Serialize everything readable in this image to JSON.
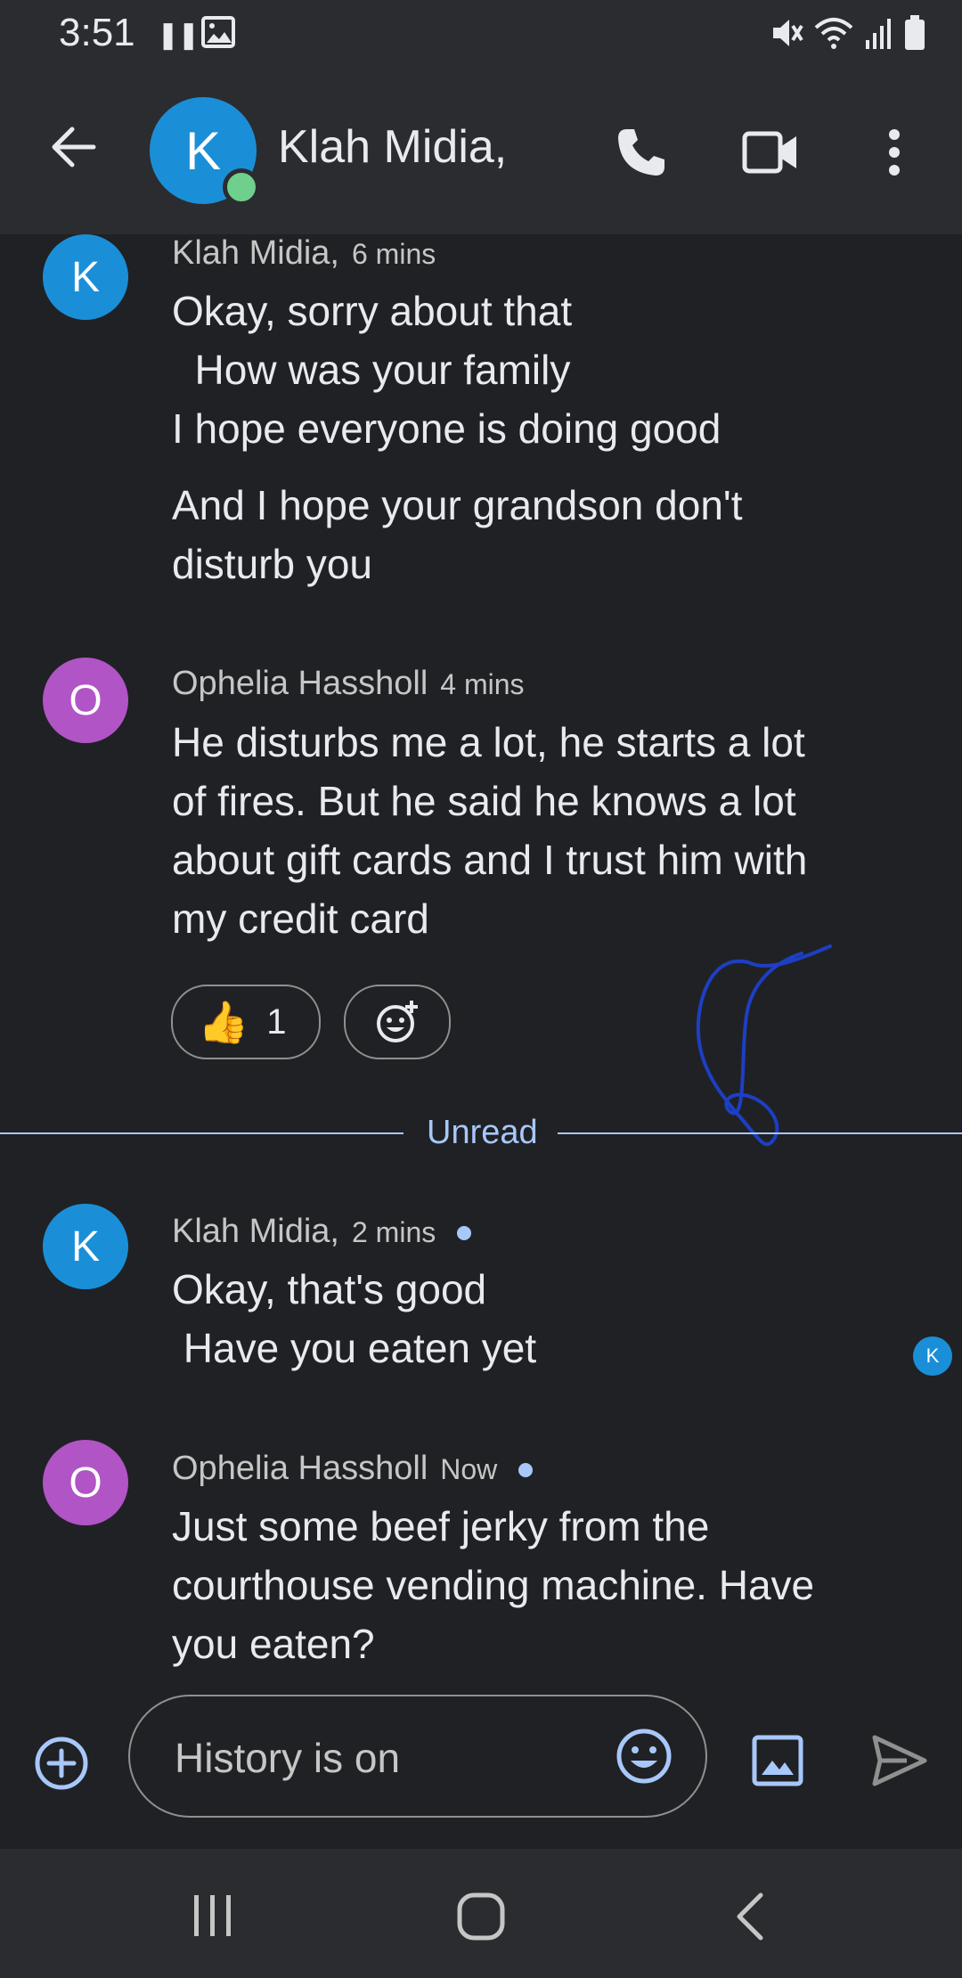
{
  "status_bar": {
    "time": "3:51"
  },
  "header": {
    "contact_name": "Klah Midia,",
    "avatar_letter": "K"
  },
  "messages": [
    {
      "avatar_letter": "K",
      "sender": "Klah Midia,",
      "time": "6 mins",
      "lines": [
        "Okay, sorry about that",
        "  How was your family",
        "I hope everyone is doing good"
      ],
      "lines2": [
        "And I hope your grandson don't",
        "disturb you"
      ]
    },
    {
      "avatar_letter": "O",
      "sender": "Ophelia Hassholl",
      "time": "4 mins",
      "lines": [
        "He disturbs me a lot, he starts a lot",
        "of fires. But he said he knows a lot",
        "about gift cards and I trust him with",
        "my credit card"
      ],
      "reaction": {
        "emoji": "👍",
        "count": "1"
      }
    },
    {
      "avatar_letter": "K",
      "sender": "Klah Midia,",
      "time": "2 mins",
      "lines": [
        "Okay, that's good",
        " Have you eaten yet"
      ]
    },
    {
      "avatar_letter": "O",
      "sender": "Ophelia Hassholl",
      "time": "Now",
      "lines": [
        "Just some beef jerky from the",
        "courthouse vending machine. Have",
        "you eaten?"
      ]
    }
  ],
  "divider": {
    "label": "Unread"
  },
  "read_receipt": {
    "letter": "K"
  },
  "composer": {
    "placeholder": "History is on"
  },
  "colors": {
    "background": "#202124",
    "bar": "#2b2c2f",
    "accent": "#a8c7fa",
    "avatar_k": "#1a8fd8",
    "avatar_o": "#b154c6",
    "online": "#6fcf8d"
  },
  "icons": [
    "back-arrow-icon",
    "phone-icon",
    "video-icon",
    "more-vert-icon",
    "add-circle-icon",
    "emoji-icon",
    "gallery-icon",
    "send-icon",
    "add-reaction-icon"
  ]
}
